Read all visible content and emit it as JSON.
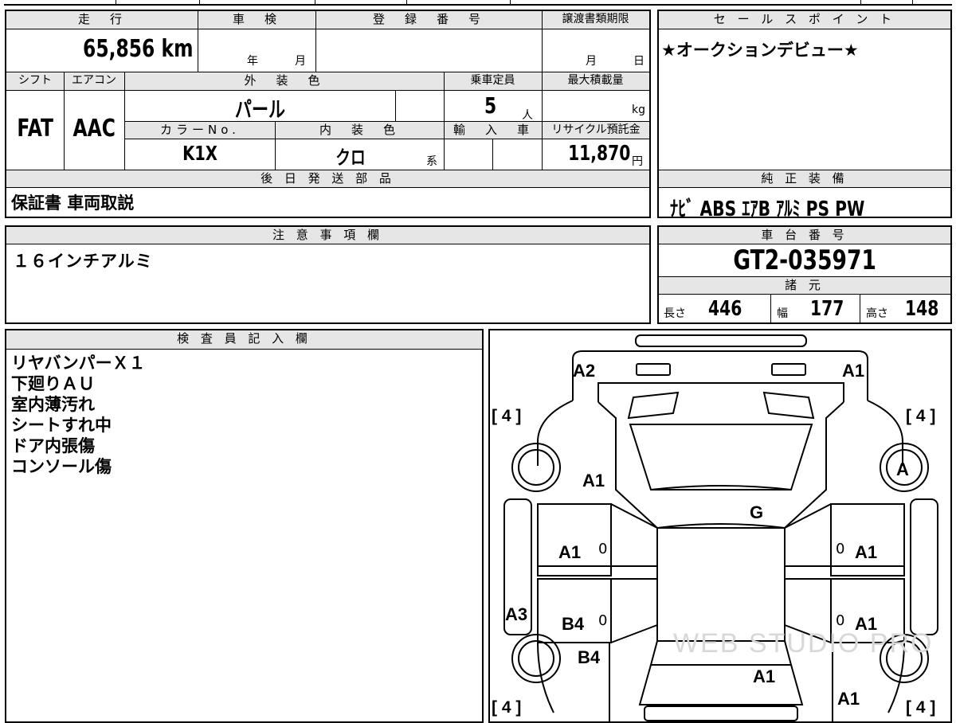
{
  "vehicle": {
    "mileage_label": "走　行",
    "mileage": "65,856",
    "mileage_unit": "km",
    "inspection_label": "車　検",
    "inspection_year": "年",
    "inspection_month": "月",
    "registration_label": "登　録　番　号",
    "transfer_label": "譲渡書類期限",
    "transfer_month": "月",
    "transfer_day": "日",
    "shift_label": "シフト",
    "shift": "FAT",
    "ac_label": "エアコン",
    "ac": "AAC",
    "exterior_label": "外　装　色",
    "exterior_color": "パール",
    "capacity_label": "乗車定員",
    "capacity": "5",
    "capacity_unit": "人",
    "max_load_label": "最大積載量",
    "max_load_unit": "kg",
    "color_no_label": "カラーNo.",
    "color_no": "K1X",
    "interior_label": "内　装　色",
    "interior_color": "クロ",
    "interior_suffix": "系",
    "import_label": "輸　入　車",
    "recycle_label": "リサイクル預託金",
    "recycle_fee": "11,870",
    "recycle_unit": "円"
  },
  "sales_point": {
    "label": "セ ー ル ス ポ イ ン ト",
    "text": "★オークションデビュー★"
  },
  "shipping": {
    "label": "後 日 発 送 部 品",
    "text": "保証書 車両取説"
  },
  "equipment": {
    "label": "純 正 装 備",
    "text": "ﾅﾋﾞ ABS ｴｱB ｱﾙﾐ PS PW"
  },
  "caution": {
    "label": "注 意 事 項 欄",
    "text": "１６インチアルミ"
  },
  "chassis": {
    "label": "車 台 番 号",
    "number": "GT2-035971",
    "spec_label": "諸 元",
    "length_label": "長さ",
    "length": "446",
    "width_label": "幅",
    "width": "177",
    "height_label": "高さ",
    "height": "148"
  },
  "inspector": {
    "label": "検 査 員 記 入 欄",
    "notes": [
      "リヤバンパーＸ１",
      "下廻りＡＵ",
      "室内薄汚れ",
      "シートすれ中",
      "ドア内張傷",
      "コンソール傷"
    ]
  },
  "diagram": {
    "marks": {
      "front_left": "A2",
      "front_right": "A1",
      "tire_tl": "[ 4 ]",
      "tire_tr": "[ 4 ]",
      "tire_bl": "[ 4 ]",
      "tire_br": "[ 4 ]",
      "left_fender": "A1",
      "right_wheel": "A",
      "windshield": "G",
      "left_front_door": "A1",
      "right_front_door": "A1",
      "left_sill": "A3",
      "left_rear_door": "B4",
      "right_rear_door": "A1",
      "left_rear_fender": "B4",
      "trunk": "A1",
      "rear_right": "A1",
      "door_zero_1": "0",
      "door_zero_2": "0",
      "door_zero_3": "0",
      "door_zero_4": "0"
    },
    "watermark": "WEB STUDIO PRO"
  }
}
